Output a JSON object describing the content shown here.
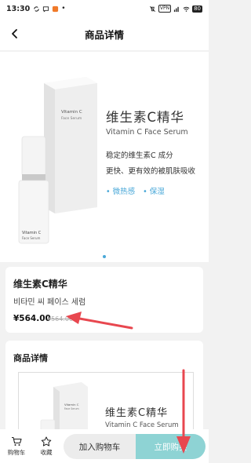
{
  "status_bar": {
    "time": "13:30",
    "vpn_label": "VPN",
    "battery": "80"
  },
  "header": {
    "title": "商品详情"
  },
  "hero": {
    "title": "维生素C精华",
    "subtitle": "Vitamin C Face Serum",
    "line1": "稳定的维生素C 成分",
    "line2": "更快、更有效的被肌肤吸收",
    "tags": [
      "• 微热感",
      "• 保湿"
    ],
    "bottle_label_1": "Vitamin C",
    "bottle_label_2": "Face Serum",
    "box_label_1": "Vitamin C",
    "box_label_2": "Face Serum",
    "bottle_small_label": "Vitamin C",
    "bottle_small_label_2": "Face Serum"
  },
  "product": {
    "name": "维生素C精华",
    "korean_name": "비타민 씨 페이스 세럼",
    "price": "¥564.00",
    "original_price": "¥564.00"
  },
  "details": {
    "title": "商品详情",
    "image_title": "维生素C精华",
    "image_subtitle": "Vitamin C Face Serum"
  },
  "bottom_bar": {
    "cart_label": "购物车",
    "favorite_label": "收藏",
    "add_to_cart": "加入购物车",
    "buy_now": "立即购买"
  },
  "colors": {
    "accent": "#4aa8d8",
    "buy_button": "#8ed3d4",
    "annotation_arrow": "#e8474f"
  }
}
